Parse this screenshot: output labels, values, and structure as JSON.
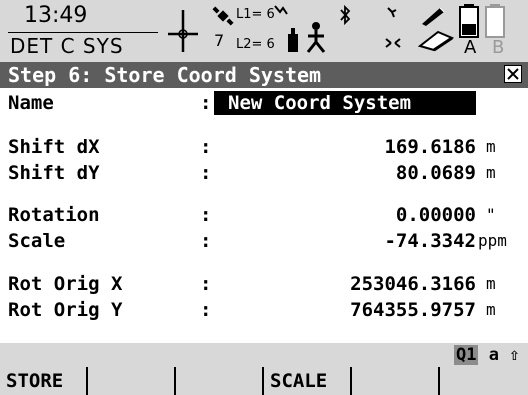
{
  "status_bar": {
    "time": "13:49",
    "coord_system_short": "DET C SYS",
    "sat_count": "7",
    "sat_l1": "L1= 6",
    "sat_l2": "L2= 6",
    "memory_a_label": "A",
    "memory_b_label": "B",
    "icons": [
      "position-mode-icon",
      "satellite-icon",
      "antenna-icon",
      "rover-user-icon",
      "bluetooth-icon",
      "radio-link-icon",
      "device-link-icon",
      "pen-icon",
      "memory-card-icon",
      "battery-icon"
    ]
  },
  "title_bar": {
    "title": "Step 6: Store Coord System",
    "close_icon": "close-icon"
  },
  "fields": {
    "name": {
      "label": "Name",
      "colon": ":",
      "value": "New Coord System"
    },
    "shift_dx": {
      "label": "Shift dX",
      "colon": ":",
      "value": "169.6186",
      "unit": "m"
    },
    "shift_dy": {
      "label": "Shift dY",
      "colon": ":",
      "value": "80.0689",
      "unit": "m"
    },
    "rotation": {
      "label": "Rotation",
      "colon": ":",
      "value": "0.00000",
      "unit": "\""
    },
    "scale": {
      "label": "Scale",
      "colon": ":",
      "value": "-74.3342",
      "unit": "ppm"
    },
    "rot_orig_x": {
      "label": "Rot Orig X",
      "colon": ":",
      "value": "253046.3166",
      "unit": "m"
    },
    "rot_orig_y": {
      "label": "Rot Orig Y",
      "colon": ":",
      "value": "764355.9757",
      "unit": "m"
    }
  },
  "input_line": {
    "mode_q1": "Q1",
    "mode_case": "a",
    "shift_icon": "shift-arrow-icon",
    "shift_glyph": "⇧"
  },
  "softkeys": [
    "STORE",
    "",
    "",
    "SCALE",
    "",
    ""
  ],
  "colors": {
    "status_bg": "#d8d8d8",
    "title_bg": "#5d5d5d",
    "highlight_bg": "#000000",
    "highlight_fg": "#ffffff"
  }
}
